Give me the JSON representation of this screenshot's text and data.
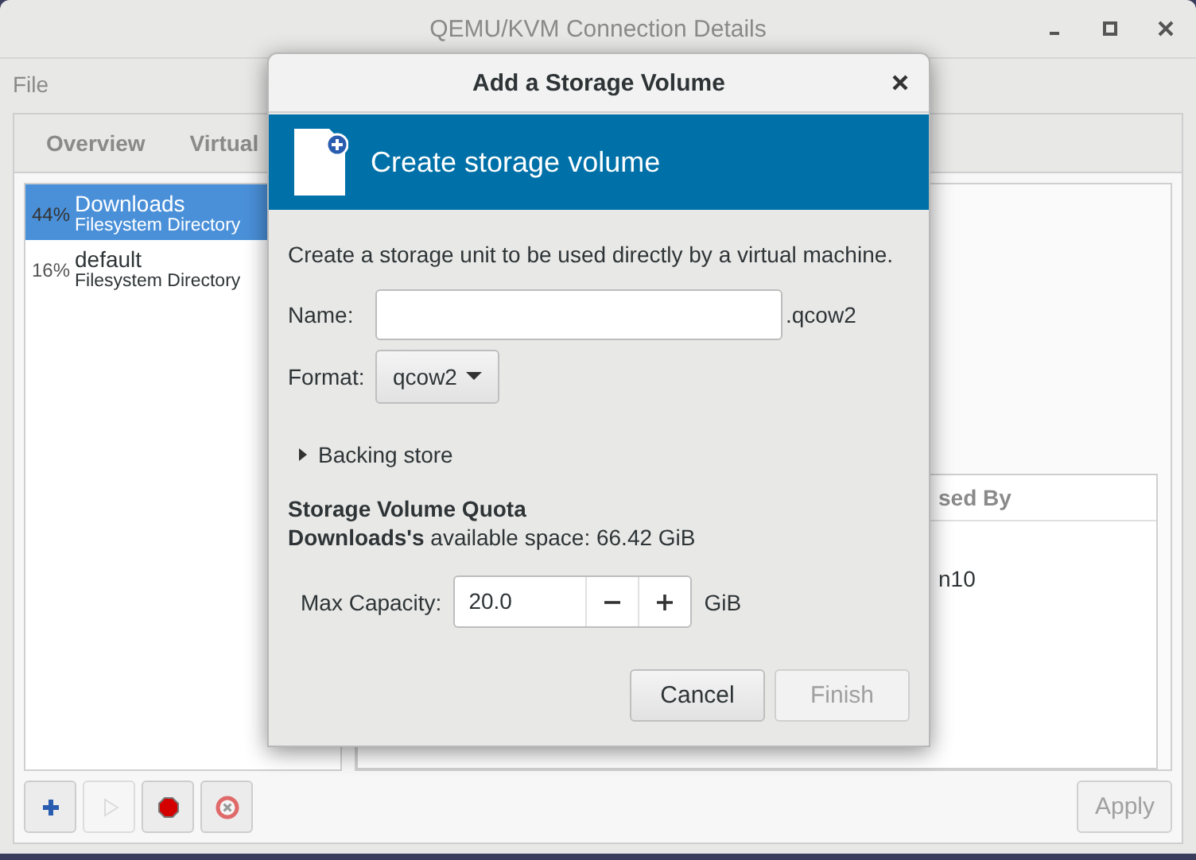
{
  "window": {
    "title": "QEMU/KVM Connection Details"
  },
  "menu": [
    "File"
  ],
  "tabs": [
    {
      "label": "Overview",
      "selected": false
    },
    {
      "label": "Virtual",
      "selected": false
    }
  ],
  "pools": [
    {
      "usage": "44%",
      "name": "Downloads",
      "type": "Filesystem Directory",
      "selected": true
    },
    {
      "usage": "16%",
      "name": "default",
      "type": "Filesystem Directory",
      "selected": false
    }
  ],
  "volumes": {
    "column_header": "sed By",
    "cell": "n10"
  },
  "pool_buttons": [
    {
      "kind": "add",
      "disabled": false
    },
    {
      "kind": "start",
      "disabled": true
    },
    {
      "kind": "stop",
      "disabled": false
    },
    {
      "kind": "delete",
      "disabled": false
    }
  ],
  "apply_button": {
    "label": "Apply",
    "disabled": true
  },
  "dialog": {
    "title": "Add a Storage Volume",
    "banner": "Create storage volume",
    "description": "Create a storage unit to be used directly by a virtual machine.",
    "name": {
      "label": "Name:",
      "suffix": ".qcow2"
    },
    "format": {
      "label": "Format:",
      "value": "qcow2"
    },
    "backing_store": {
      "label": "Backing store",
      "expanded": false
    },
    "quota": {
      "title": "Storage Volume Quota",
      "text": "**Downloads's** available space: 66.42 GiB"
    },
    "capacity": {
      "label": "Max Capacity:",
      "value": "20.0",
      "unit": "GiB"
    },
    "buttons": [
      {
        "label": "Cancel",
        "disabled": false
      },
      {
        "label": "Finish",
        "disabled": true
      }
    ]
  }
}
